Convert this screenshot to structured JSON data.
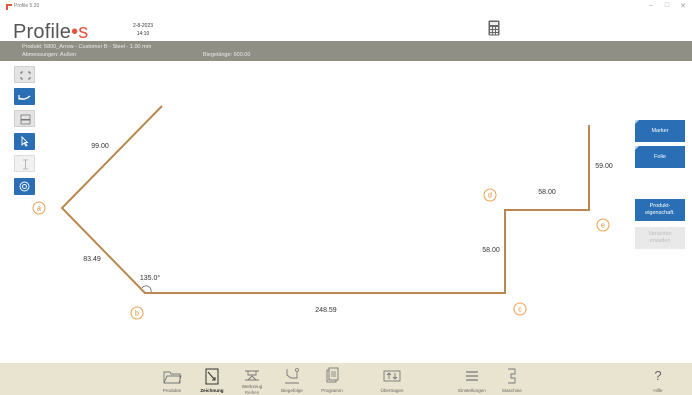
{
  "window": {
    "title": "Profile 5.20",
    "controls": [
      "–",
      "□",
      "✕"
    ]
  },
  "header": {
    "logo_main": "Profile",
    "logo_dot": "•",
    "logo_s": "s",
    "date": "2-8-2023",
    "time": "14:10",
    "calculator_icon": "calculator-icon"
  },
  "info": {
    "product_line": "Produkt: 5800_Arrow - Customer B - Steel - 1.00 mm",
    "dimensions": "Abmessungen: Außen",
    "bend_length": "Biegelänge: 600.00"
  },
  "tools": [
    "select-area-icon",
    "undo-icon",
    "panel-icon",
    "pointer-icon",
    "text-cursor-icon",
    "settings-circle-icon"
  ],
  "drawing": {
    "colors": {
      "line": "#b9874f",
      "label_circle": "#f0a050",
      "text": "#333333"
    },
    "points": [
      "a",
      "b",
      "c",
      "d",
      "e"
    ],
    "dimensions": {
      "seg1": "99.00",
      "seg2": "83.49",
      "seg3": "248.59",
      "seg4": "58.00",
      "seg5": "58.00",
      "seg6": "59.00"
    },
    "angle": "135.0°"
  },
  "right_buttons": {
    "marker": "Marker",
    "folie": "Folie",
    "product_props": "Produkt-eigenschaft.",
    "variants": "Varianten erstellen"
  },
  "nav": [
    {
      "label": "Produkte",
      "icon": "folder-icon"
    },
    {
      "label": "Zeichnung",
      "icon": "drawing-icon"
    },
    {
      "label": "Werkzeug",
      "icon": "tool-icon",
      "sub": "Reihen"
    },
    {
      "label": "Biegefolge",
      "icon": "bend-sequence-icon"
    },
    {
      "label": "Programm",
      "icon": "program-icon"
    },
    {
      "label": "Übertragen",
      "icon": "transfer-icon"
    },
    {
      "label": "Einstellungen",
      "icon": "settings-list-icon"
    },
    {
      "label": "Maschine",
      "icon": "machine-icon"
    }
  ],
  "help": {
    "symbol": "?",
    "label": "Hilfe"
  }
}
